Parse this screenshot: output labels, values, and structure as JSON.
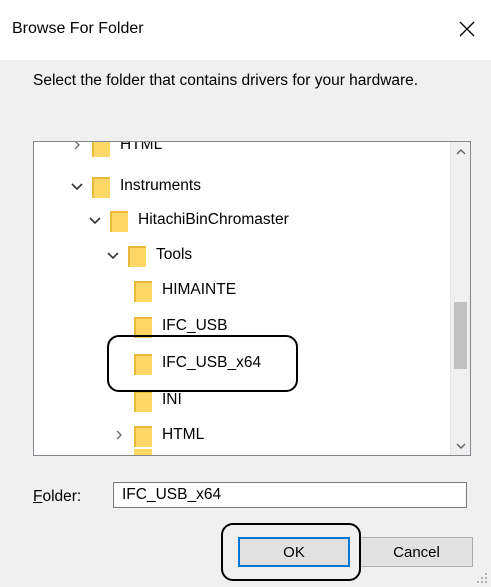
{
  "window": {
    "title": "Browse For Folder",
    "close_glyph": "✕"
  },
  "prompt": "Select the folder that contains drivers for your hardware.",
  "tree": {
    "items": [
      {
        "label": "HTML",
        "expanded": false,
        "partial": true,
        "icon": "folder-icon"
      },
      {
        "label": "Instruments",
        "expanded": true,
        "icon": "folder-icon"
      },
      {
        "label": "HitachiBinChromaster",
        "expanded": true,
        "icon": "folder-icon"
      },
      {
        "label": "Tools",
        "expanded": true,
        "icon": "folder-icon"
      },
      {
        "label": "HIMAINTE",
        "icon": "folder-icon"
      },
      {
        "label": "IFC_USB",
        "icon": "folder-icon"
      },
      {
        "label": "IFC_USB_x64",
        "icon": "folder-icon",
        "highlighted": true
      },
      {
        "label": "INI",
        "icon": "folder-icon"
      },
      {
        "label": "HTML",
        "expanded": false,
        "icon": "folder-icon"
      }
    ],
    "scroll_up_icon": "chevron-up-icon",
    "scroll_down_icon": "chevron-down-icon"
  },
  "folder_field": {
    "label_accel": "F",
    "label_rest": "older:",
    "value": "IFC_USB_x64"
  },
  "buttons": {
    "ok": "OK",
    "cancel": "Cancel"
  },
  "colors": {
    "folder": "#ffd766",
    "folder_shade": "#e8b93a",
    "accent": "#0078d7"
  }
}
